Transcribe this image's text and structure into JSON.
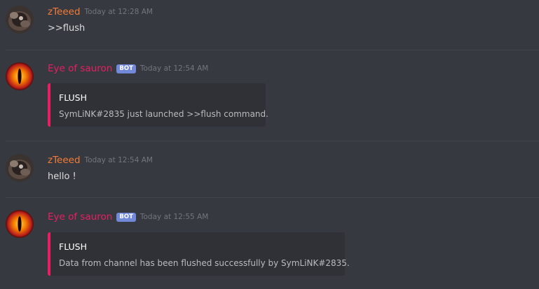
{
  "colors": {
    "background": "#36393f",
    "user_name": "#f47b37",
    "bot_name": "#e91e63",
    "bot_tag": "#7289da",
    "embed_bar": "#e91e63",
    "embed_bg": "#2f3136",
    "timestamp": "#72767d",
    "text": "#dcddde"
  },
  "messages": [
    {
      "author": "zTeeed",
      "timestamp": "Today at 12:28 AM",
      "text": ">>flush",
      "avatar_icon": "dark-creature-avatar"
    },
    {
      "author": "Eye of sauron",
      "bot_tag": "BOT",
      "timestamp": "Today at 12:54 AM",
      "avatar_icon": "eye-of-sauron-avatar",
      "embed": {
        "title": "FLUSH",
        "description": "SymLiNK#2835 just launched >>flush command."
      }
    },
    {
      "author": "zTeeed",
      "timestamp": "Today at 12:54 AM",
      "text": "hello !",
      "avatar_icon": "dark-creature-avatar"
    },
    {
      "author": "Eye of sauron",
      "bot_tag": "BOT",
      "timestamp": "Today at 12:55 AM",
      "avatar_icon": "eye-of-sauron-avatar",
      "embed": {
        "title": "FLUSH",
        "description": "Data from channel has been flushed successfully by SymLiNK#2835."
      }
    }
  ]
}
